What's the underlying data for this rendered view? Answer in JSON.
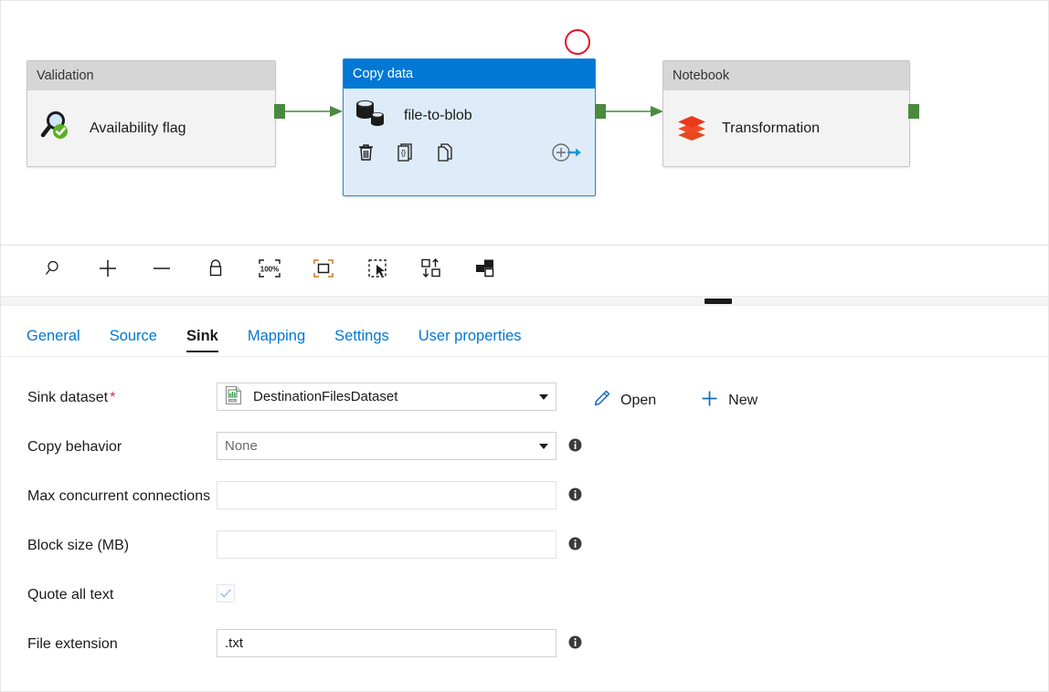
{
  "canvas": {
    "nodes": [
      {
        "type_label": "Validation",
        "name": "Availability flag",
        "icon": "magnifier-check-icon",
        "selected": false
      },
      {
        "type_label": "Copy data",
        "name": "file-to-blob",
        "icon": "copy-data-database-icon",
        "selected": true,
        "actions": [
          "delete-icon",
          "code-braces-icon",
          "clone-icon",
          "add-output-icon"
        ]
      },
      {
        "type_label": "Notebook",
        "name": "Transformation",
        "icon": "databricks-layers-icon",
        "selected": false
      }
    ],
    "annotation": "red-highlight-circle",
    "colors": {
      "selected_header": "#0078d4",
      "selected_body": "#deecf9",
      "node_header": "#d6d6d6",
      "node_body": "#f3f3f3",
      "connector": "#4a8a3f",
      "annotation": "#e81123"
    }
  },
  "toolbar": {
    "items": [
      {
        "icon": "zoom-search-icon",
        "name": "search-button"
      },
      {
        "icon": "plus-icon",
        "name": "zoom-in-button"
      },
      {
        "icon": "minus-icon",
        "name": "zoom-out-button"
      },
      {
        "icon": "lock-icon",
        "name": "lock-canvas-button"
      },
      {
        "icon": "zoom-100-percent-icon",
        "name": "zoom-to-hundred-button",
        "label": "100%"
      },
      {
        "icon": "fit-to-screen-icon",
        "name": "fit-to-screen-button"
      },
      {
        "icon": "select-cursor-icon",
        "name": "select-mode-button"
      },
      {
        "icon": "auto-align-icon",
        "name": "auto-align-button"
      },
      {
        "icon": "group-layout-icon",
        "name": "group-layout-button"
      }
    ]
  },
  "tabs": [
    {
      "label": "General",
      "active": false
    },
    {
      "label": "Source",
      "active": false
    },
    {
      "label": "Sink",
      "active": true
    },
    {
      "label": "Mapping",
      "active": false
    },
    {
      "label": "Settings",
      "active": false
    },
    {
      "label": "User properties",
      "active": false
    }
  ],
  "form": {
    "sink_dataset": {
      "label": "Sink dataset",
      "required_mark": "*",
      "value": "DestinationFilesDataset",
      "icon": "csv-dataset-icon",
      "open_label": "Open",
      "open_icon": "pencil-icon",
      "new_label": "New",
      "new_icon": "plus-icon"
    },
    "copy_behavior": {
      "label": "Copy behavior",
      "value": "None"
    },
    "max_concurrent_connections": {
      "label": "Max concurrent connections",
      "value": "",
      "placeholder": ""
    },
    "block_size": {
      "label": "Block size (MB)",
      "value": "",
      "placeholder": ""
    },
    "quote_all_text": {
      "label": "Quote all text",
      "checked": true,
      "check_glyph": "✓"
    },
    "file_extension": {
      "label": "File extension",
      "value": ".txt"
    },
    "info_icon": "info-icon"
  }
}
